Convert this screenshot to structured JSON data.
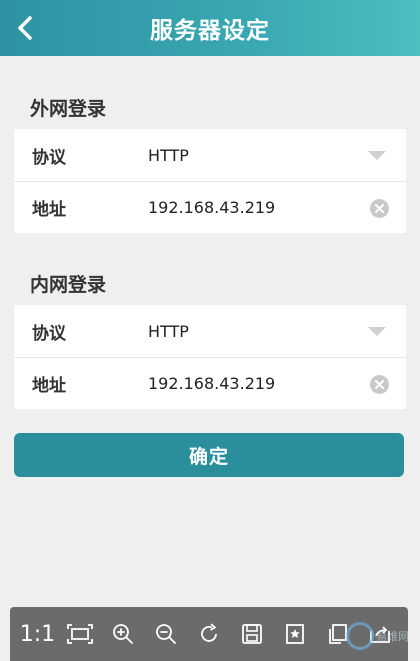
{
  "header": {
    "title": "服务器设定"
  },
  "sections": [
    {
      "title": "外网登录",
      "protocol_label": "协议",
      "protocol_value": "HTTP",
      "address_label": "地址",
      "address_value": "192.168.43.219"
    },
    {
      "title": "内网登录",
      "protocol_label": "协议",
      "protocol_value": "HTTP",
      "address_label": "地址",
      "address_value": "192.168.43.219"
    }
  ],
  "confirm_label": "确定",
  "viewer_toolbar": {
    "actual_size_label": "1:1",
    "icons": [
      "fit-screen-icon",
      "zoom-in-icon",
      "zoom-out-icon",
      "rotate-icon",
      "save-icon",
      "bookmark-icon",
      "copy-icon",
      "share-icon"
    ]
  },
  "colors": {
    "header_start": "#2d93a3",
    "header_end": "#4cbfc1",
    "button": "#2b8e9c",
    "background": "#efeff0"
  },
  "watermark_text": "易维网"
}
